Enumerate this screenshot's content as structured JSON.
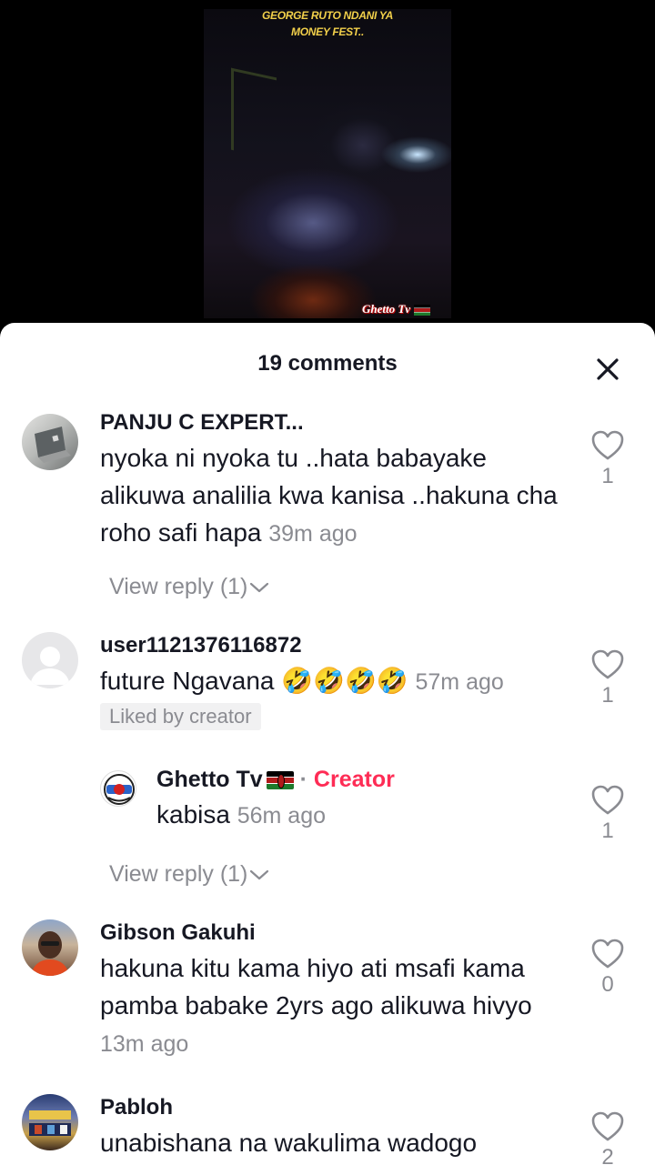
{
  "video": {
    "title_line1": "GEORGE RUTO NDANI YA",
    "title_line2": "MONEY FEST..",
    "watermark": "Ghetto Tv"
  },
  "sheet": {
    "title": "19 comments",
    "close_icon": "close-icon"
  },
  "comments": [
    {
      "username": "PANJU C EXPERT...",
      "text": "nyoka ni nyoka tu ..hata babayake alikuwa analilia kwa kanisa ..hakuna cha roho safi hapa",
      "time": "39m ago",
      "likes": "1",
      "view_reply": "View reply (1)"
    },
    {
      "username": "user1121376116872",
      "text": "future Ngavana 🤣🤣🤣🤣",
      "time": "57m ago",
      "likes": "1",
      "badge": "Liked by creator"
    },
    {
      "username": "Ghetto Tv",
      "separator": "·",
      "creator_label": "Creator",
      "text": "kabisa",
      "time": "56m ago",
      "likes": "1",
      "view_reply": "View reply (1)"
    },
    {
      "username": "Gibson Gakuhi",
      "text": "hakuna kitu kama hiyo ati msafi kama pamba babake 2yrs ago alikuwa hivyo",
      "time": "13m ago",
      "likes": "0"
    },
    {
      "username": "Pabloh",
      "text": "unabishana na wakulima wadogo",
      "likes": "2"
    }
  ],
  "colors": {
    "accent_creator": "#fe2c55",
    "muted": "#8a8b91",
    "text": "#161823"
  }
}
